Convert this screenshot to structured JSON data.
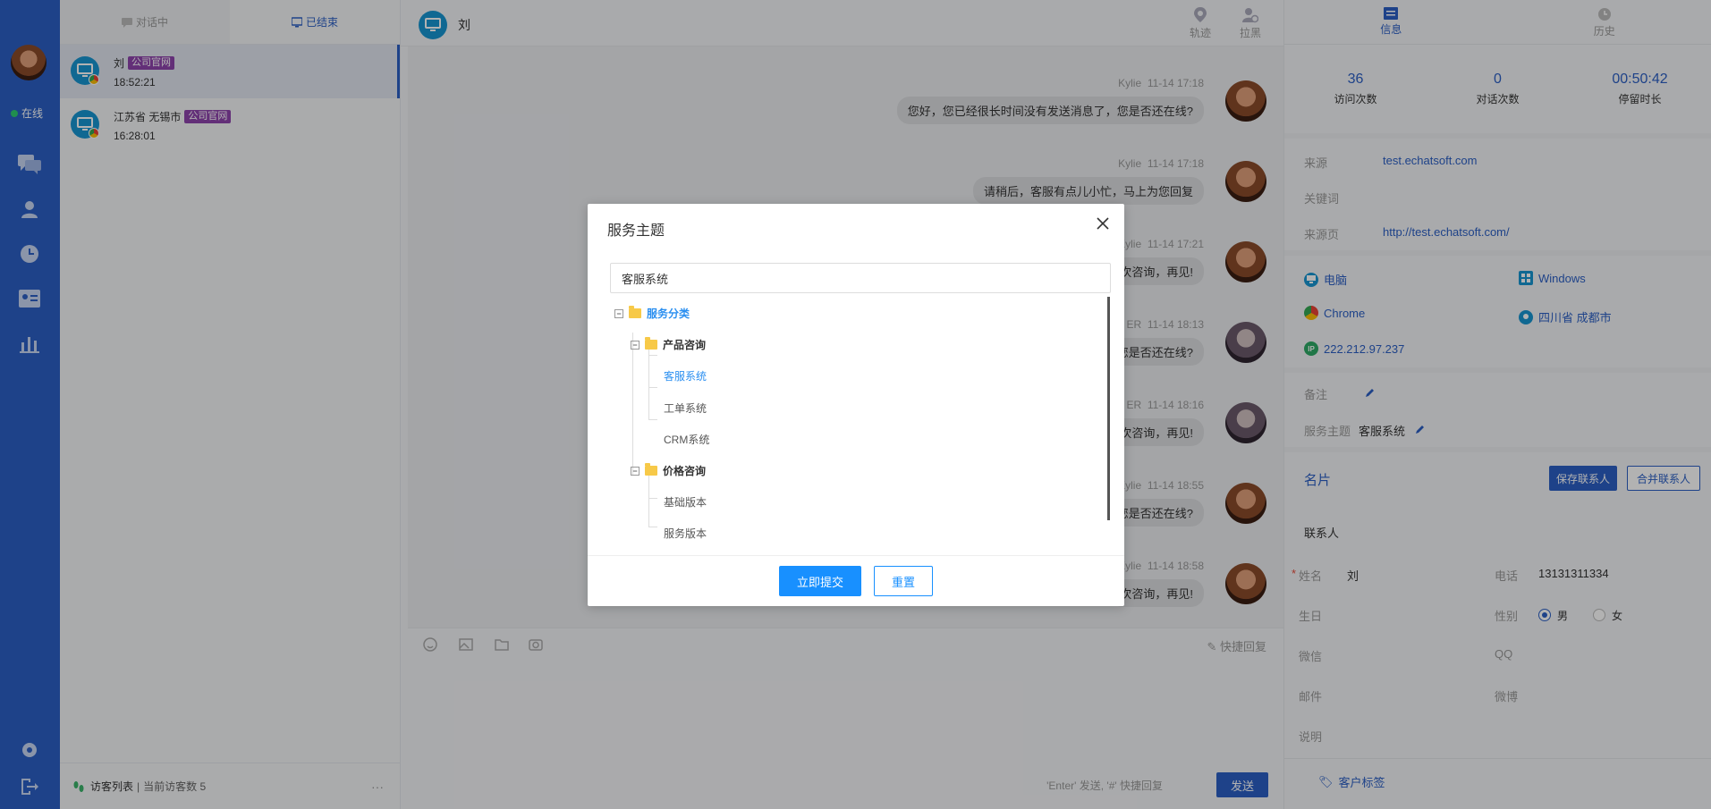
{
  "sidebar": {
    "status_label": "在线",
    "colors": {
      "rail": "#2b5fc4",
      "online": "#2ecc71"
    }
  },
  "sessions": {
    "tabs": [
      {
        "label": "对话中",
        "icon": "chat-bubble-icon"
      },
      {
        "label": "已结束",
        "icon": "monitor-icon"
      }
    ],
    "items": [
      {
        "name": "刘",
        "tag": "公司官网",
        "time": "18:52:21"
      },
      {
        "name": "江苏省 无锡市",
        "tag": "公司官网",
        "time": "16:28:01"
      }
    ],
    "footer": {
      "label": "访客列表",
      "count_text": "当前访客数 5",
      "more": "···"
    }
  },
  "chat": {
    "title": "刘",
    "header_buttons": [
      {
        "label": "轨迹",
        "icon": "location-pin-icon"
      },
      {
        "label": "拉黑",
        "icon": "block-user-icon"
      }
    ],
    "messages": [
      {
        "sender": "Kylie",
        "time": "11-14 17:18",
        "text": "您好，您已经很长时间没有发送消息了，您是否还在线?"
      },
      {
        "sender": "Kylie",
        "time": "11-14 17:18",
        "text": "请稍后，客服有点儿小忙，马上为您回复"
      },
      {
        "sender": "Kylie",
        "time": "11-14 17:21",
        "text": "次咨询，再见!"
      },
      {
        "sender": "ER",
        "time": "11-14 18:13",
        "text": "您是否还在线?"
      },
      {
        "sender": "ER",
        "time": "11-14 18:16",
        "text": "次咨询，再见!"
      },
      {
        "sender": "Kylie",
        "time": "11-14 18:55",
        "text": "您是否还在线?"
      },
      {
        "sender": "Kylie",
        "time": "11-14 18:58",
        "text": "次咨询，再见!"
      }
    ],
    "quick_reply": "快捷回复",
    "send_hint": "'Enter' 发送, '#' 快捷回复",
    "send_label": "发送"
  },
  "info": {
    "tabs": [
      {
        "label": "信息",
        "icon": "id-card-icon"
      },
      {
        "label": "历史",
        "icon": "clock-icon"
      }
    ],
    "stats": [
      {
        "value": "36",
        "label": "访问次数"
      },
      {
        "value": "0",
        "label": "对话次数"
      },
      {
        "value": "00:50:42",
        "label": "停留时长"
      }
    ],
    "source_label": "来源",
    "source_value": "test.echatsoft.com",
    "keyword_label": "关键词",
    "page_label": "来源页",
    "page_value": "http://test.echatsoft.com/",
    "device": "电脑",
    "os": "Windows",
    "browser": "Chrome",
    "location": "四川省 成都市",
    "ip": "222.212.97.237",
    "note_label": "备注",
    "topic_label": "服务主题",
    "topic_value": "客服系统",
    "card_title": "名片",
    "save_contact": "保存联系人",
    "merge_contact": "合并联系人",
    "contact_section": "联系人",
    "name_label": "姓名",
    "name_value": "刘",
    "phone_label": "电话",
    "phone_value": "13131311334",
    "birthday_label": "生日",
    "gender_label": "性别",
    "gender_male": "男",
    "gender_female": "女",
    "wechat_label": "微信",
    "qq_label": "QQ",
    "email_label": "邮件",
    "weibo_label": "微博",
    "desc_label": "说明",
    "tags_label": "客户标签"
  },
  "dialog": {
    "title": "服务主题",
    "search_value": "客服系统",
    "tree": {
      "root": "服务分类",
      "groups": [
        {
          "label": "产品咨询",
          "children": [
            "客服系统",
            "工单系统",
            "CRM系统"
          ]
        },
        {
          "label": "价格咨询",
          "children": [
            "基础版本",
            "服务版本"
          ]
        }
      ]
    },
    "submit_label": "立即提交",
    "reset_label": "重置"
  }
}
